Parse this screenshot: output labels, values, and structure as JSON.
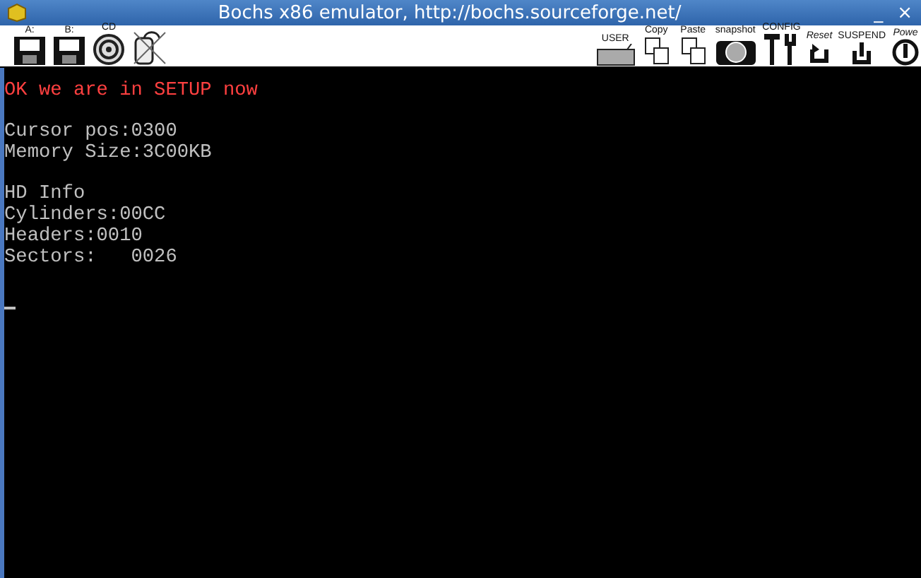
{
  "window": {
    "title": "Bochs x86 emulator, http://bochs.sourceforge.net/",
    "controls": [
      "_",
      "×"
    ]
  },
  "toolbar_left": [
    {
      "kind": "floppy",
      "label": "A:"
    },
    {
      "kind": "floppy",
      "label": "B:"
    },
    {
      "kind": "cdrom",
      "label": "CD"
    },
    {
      "kind": "mouse"
    }
  ],
  "toolbar_right": [
    {
      "kind": "keyboard",
      "label": "USER"
    },
    {
      "kind": "copy",
      "label": "Copy"
    },
    {
      "kind": "paste",
      "label": "Paste"
    },
    {
      "kind": "camera",
      "label": "snapshot"
    },
    {
      "kind": "config",
      "label": "CONFIG"
    },
    {
      "kind": "reset",
      "label": "Reset"
    },
    {
      "kind": "suspend",
      "label": "SUSPEND"
    },
    {
      "kind": "power",
      "label": "Powe"
    }
  ],
  "console": {
    "blocks": [
      [
        {
          "text": "OK we are in SETUP now",
          "color": "#ff4040"
        }
      ],
      [
        {
          "text": "Cursor pos:0300",
          "color": "#c0c0c0"
        },
        {
          "text": "Memory Size:3C00KB",
          "color": "#c0c0c0"
        }
      ],
      [
        {
          "text": "HD Info",
          "color": "#c0c0c0"
        },
        {
          "text": "Cylinders:00CC",
          "color": "#c0c0c0"
        },
        {
          "text": "Headers:0010",
          "color": "#c0c0c0"
        },
        {
          "text": "Sectors:   0026",
          "color": "#c0c0c0"
        }
      ]
    ],
    "cursor": true
  }
}
